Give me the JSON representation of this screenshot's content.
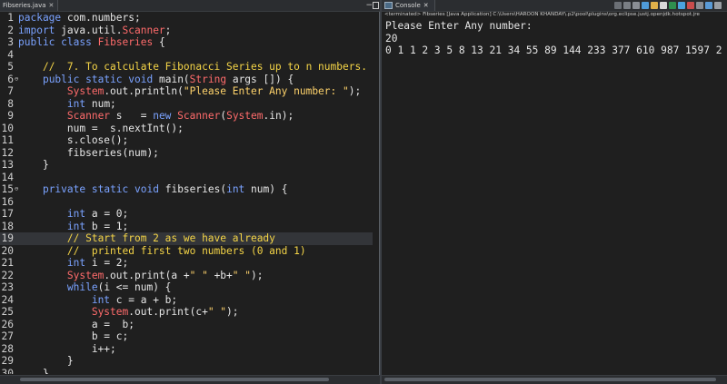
{
  "editor": {
    "tab_label": "Fibseries.java",
    "close_glyph": "✕",
    "lines": [
      {
        "n": "1",
        "t": "package com.numbers;"
      },
      {
        "n": "2",
        "t": "import java.util.Scanner;"
      },
      {
        "n": "3",
        "t": "public class Fibseries {"
      },
      {
        "n": "4",
        "t": ""
      },
      {
        "n": "5",
        "t": "    //  7. To calculate Fibonacci Series up to n numbers."
      },
      {
        "n": "6",
        "t": "    public static void main(String args []) {"
      },
      {
        "n": "7",
        "t": "        System.out.println(\"Please Enter Any number: \");"
      },
      {
        "n": "8",
        "t": "        int num;"
      },
      {
        "n": "9",
        "t": "        Scanner s   = new Scanner(System.in);"
      },
      {
        "n": "10",
        "t": "        num =  s.nextInt();"
      },
      {
        "n": "11",
        "t": "        s.close();"
      },
      {
        "n": "12",
        "t": "        fibseries(num);"
      },
      {
        "n": "13",
        "t": "    }"
      },
      {
        "n": "14",
        "t": ""
      },
      {
        "n": "15",
        "t": "    private static void fibseries(int num) {"
      },
      {
        "n": "16",
        "t": ""
      },
      {
        "n": "17",
        "t": "        int a = 0;"
      },
      {
        "n": "18",
        "t": "        int b = 1;"
      },
      {
        "n": "19",
        "t": "        // Start from 2 as we have already"
      },
      {
        "n": "20",
        "t": "        //  printed first two numbers (0 and 1)"
      },
      {
        "n": "21",
        "t": "        int i = 2;"
      },
      {
        "n": "22",
        "t": "        System.out.print(a +\" \" +b+\" \");"
      },
      {
        "n": "23",
        "t": "        while(i <= num) {"
      },
      {
        "n": "24",
        "t": "            int c = a + b;"
      },
      {
        "n": "25",
        "t": "            System.out.print(c+\" \");"
      },
      {
        "n": "26",
        "t": "            a =  b;"
      },
      {
        "n": "27",
        "t": "            b = c;"
      },
      {
        "n": "28",
        "t": "            i++;"
      },
      {
        "n": "29",
        "t": "        }"
      },
      {
        "n": "30",
        "t": "    }"
      }
    ]
  },
  "console": {
    "tab_label": "Console",
    "close_glyph": "✕",
    "status": "<terminated> Fibseries [Java Application] C:\\Users\\HAROON KHANDAY\\.p2\\pool\\plugins\\org.eclipse.justj.openjdk.hotspot.jre",
    "output": [
      "Please Enter Any number:",
      "20",
      "0 1 1 2 3 5 8 13 21 34 55 89 144 233 377 610 987 1597 2"
    ]
  },
  "colors": {
    "editor_bg": "#1f1f1f",
    "keyword": "#7aa2ff",
    "comment": "#f5d547",
    "string": "#ffd36b",
    "class": "#ff6b6b"
  }
}
